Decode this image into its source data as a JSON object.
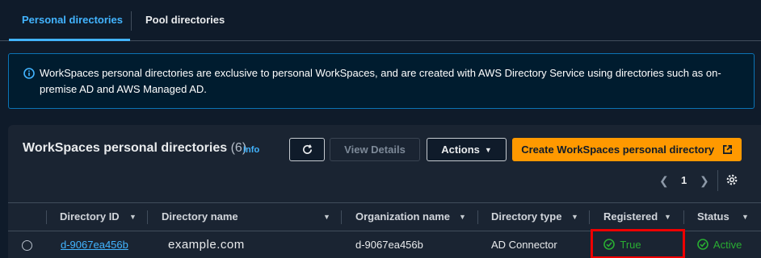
{
  "tabs": [
    {
      "label": "Personal directories",
      "active": true
    },
    {
      "label": "Pool directories",
      "active": false
    }
  ],
  "alert": {
    "icon": "info-icon",
    "text": "WorkSpaces personal directories are exclusive to personal WorkSpaces, and are created with AWS Directory Service using directories such as on-premise AD and AWS Managed AD."
  },
  "panel": {
    "title": "WorkSpaces personal directories",
    "count": "(6)",
    "info_label": "Info",
    "buttons": {
      "refresh_icon": "refresh-icon",
      "view_details": "View Details",
      "actions": "Actions",
      "create": "Create WorkSpaces personal directory"
    },
    "pagination": {
      "current_page": "1"
    }
  },
  "table": {
    "columns": [
      "Directory ID",
      "Directory name",
      "Organization name",
      "Directory type",
      "Registered",
      "Status"
    ],
    "rows": [
      {
        "directory_id": "d-9067ea456b",
        "directory_name": "example.com",
        "organization_name": "d-9067ea456b",
        "directory_type": "AD Connector",
        "registered": "True",
        "status": "Active"
      }
    ]
  },
  "colors": {
    "accent": "#42b4ff",
    "primary_button": "#ff9900",
    "success": "#29ad32",
    "highlight": "#ee0000"
  }
}
